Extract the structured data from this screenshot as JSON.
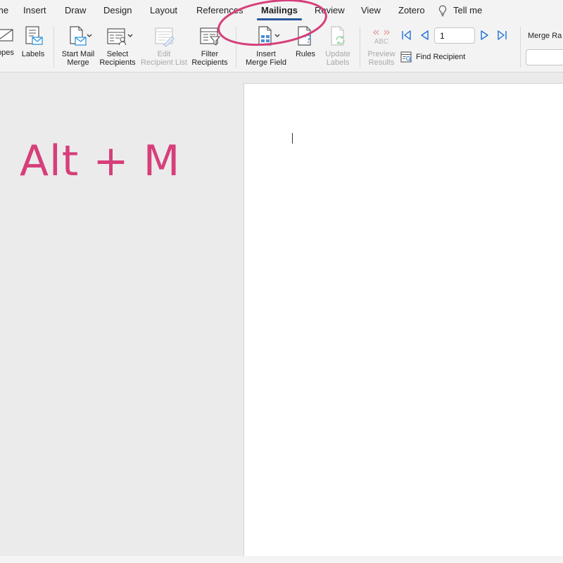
{
  "tabs": [
    {
      "label": "me",
      "active": false
    },
    {
      "label": "Insert",
      "active": false
    },
    {
      "label": "Draw",
      "active": false
    },
    {
      "label": "Design",
      "active": false
    },
    {
      "label": "Layout",
      "active": false
    },
    {
      "label": "References",
      "active": false
    },
    {
      "label": "Mailings",
      "active": true
    },
    {
      "label": "Review",
      "active": false
    },
    {
      "label": "View",
      "active": false
    },
    {
      "label": "Zotero",
      "active": false
    }
  ],
  "tell_me": {
    "label": "Tell me",
    "icon": "lightbulb-icon"
  },
  "ribbon": {
    "envelopes": {
      "label": "opes",
      "icon": "envelope-icon"
    },
    "labels": {
      "label": "Labels",
      "icon": "labels-icon"
    },
    "start_mail_merge": {
      "line1": "Start Mail",
      "line2": "Merge",
      "icon": "mail-merge-document-icon"
    },
    "select_recipients": {
      "line1": "Select",
      "line2": "Recipients",
      "icon": "recipients-list-icon"
    },
    "edit_recipient_list": {
      "line1": "Edit",
      "line2": "Recipient List",
      "icon": "edit-list-icon",
      "disabled": true
    },
    "filter_recipients": {
      "line1": "Filter",
      "line2": "Recipients",
      "icon": "filter-list-icon"
    },
    "insert_merge_field": {
      "line1": "Insert",
      "line2": "Merge Field",
      "icon": "merge-field-icon"
    },
    "rules": {
      "label": "Rules",
      "icon": "rules-document-icon"
    },
    "update_labels": {
      "line1": "Update",
      "line2": "Labels",
      "icon": "update-labels-icon",
      "disabled": true
    },
    "preview_results": {
      "badge": "ABC",
      "line1": "Preview",
      "line2": "Results",
      "icon": "preview-abc-icon",
      "disabled": true
    },
    "record_number": "1",
    "find_recipient": {
      "label": "Find Recipient",
      "icon": "find-recipient-icon"
    },
    "merge_range": {
      "label": "Merge Ra"
    }
  },
  "overlay": {
    "shortcut_text": "Alt + M",
    "highlight_color": "#d63f7a"
  },
  "colors": {
    "accent": "#2b579a",
    "annotation": "#d63f7a",
    "nav_arrows": "#1f6fd6",
    "disabled_red": "#e08a8a"
  }
}
